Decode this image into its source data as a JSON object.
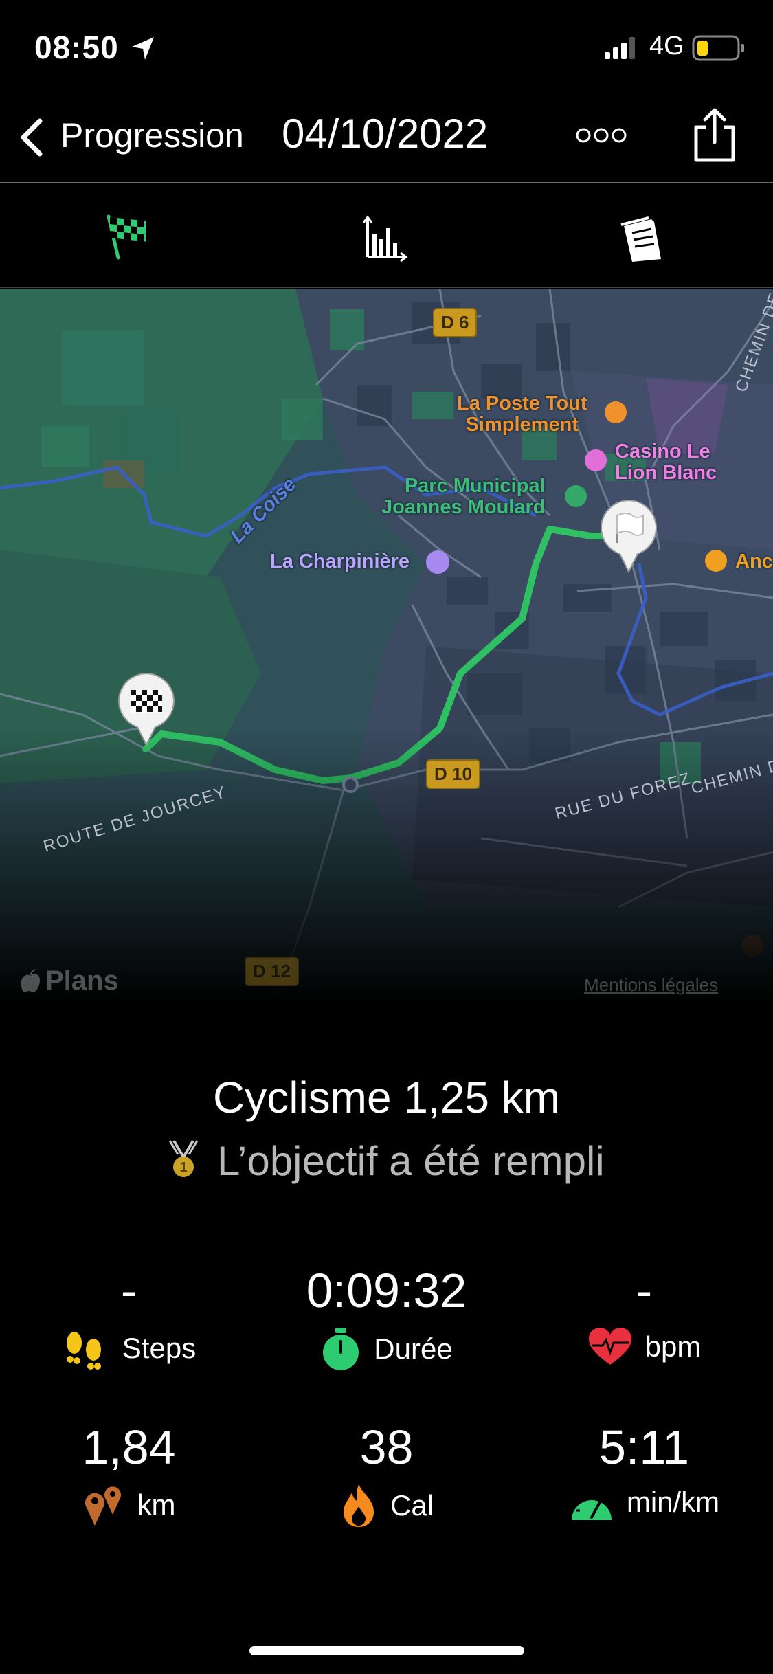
{
  "status_bar": {
    "time": "08:50",
    "network": "4G",
    "battery_color": "#ffd60a"
  },
  "nav": {
    "back_label": "Progression",
    "title": "04/10/2022",
    "more_icon": "ellipsis-icon",
    "share_icon": "share-icon"
  },
  "tabs": [
    {
      "name": "finish-flag-icon",
      "active": true,
      "color": "#2ecc71"
    },
    {
      "name": "bar-chart-icon",
      "active": false
    },
    {
      "name": "receipt-icon",
      "active": false
    }
  ],
  "map": {
    "labels": {
      "poste": "La Poste Tout\nSimplement",
      "casino": "Casino Le\nLion Blanc",
      "parc": "Parc Municipal\nJoannes Moulard",
      "charpiniere": "La Charpinière",
      "coise": "La Coise",
      "anc": "Anc",
      "plans": "Plans",
      "mentions": "Mentions légales"
    },
    "roads": {
      "d6": "D 6",
      "d10": "D 10",
      "d12": "D 12",
      "route_jourcey": "ROUTE DE JOURCEY",
      "rue_forez": "RUE DU FOREZ",
      "chemin_d": "CHEMIN D",
      "chemin_de": "CHEMIN DE"
    },
    "route_color": "#2fc064"
  },
  "summary": {
    "title": "Cyclisme 1,25 km",
    "goal": "L’objectif a été rempli"
  },
  "stats": [
    {
      "value": "-",
      "label": "Steps",
      "icon": "footprints-icon"
    },
    {
      "value": "0:09:32",
      "label": "Durée",
      "icon": "stopwatch-icon"
    },
    {
      "value": "-",
      "label": "bpm",
      "icon": "heart-icon"
    },
    {
      "value": "1,84",
      "label": "km",
      "icon": "map-pin-icon"
    },
    {
      "value": "38",
      "label": "Cal",
      "icon": "flame-icon"
    },
    {
      "value": "5:11",
      "label": "min/km",
      "icon": "speedometer-icon"
    }
  ]
}
